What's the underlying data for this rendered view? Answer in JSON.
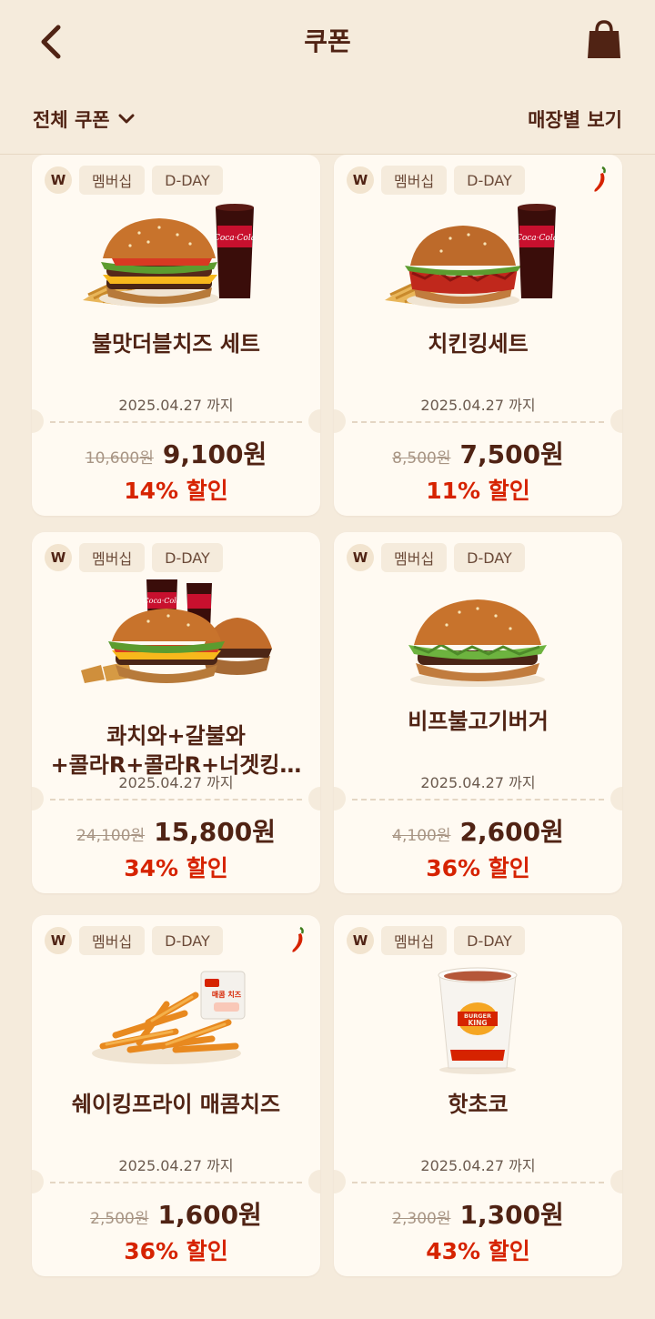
{
  "header": {
    "title": "쿠폰",
    "filter_label": "전체 쿠폰",
    "store_view_label": "매장별 보기"
  },
  "icons": {
    "back": "chevron-left-icon",
    "bag": "shopping-bag-icon",
    "filter_dropdown": "chevron-down-icon",
    "spicy": "chili-pepper-icon"
  },
  "colors": {
    "background": "#f5ebdc",
    "brand_brown": "#502314",
    "discount_red": "#d62300",
    "card": "#fffaf2"
  },
  "coupons": [
    {
      "badge": "W",
      "tag1": "멤버십",
      "tag2": "D-DAY",
      "spicy": false,
      "name_line1": "불맛더블치즈 세트",
      "name_line2": "",
      "expiry": "2025.04.27 까지",
      "original_price": "10,600원",
      "price": "9,100원",
      "discount": "14% 할인"
    },
    {
      "badge": "W",
      "tag1": "멤버십",
      "tag2": "D-DAY",
      "spicy": true,
      "name_line1": "치킨킹세트",
      "name_line2": "",
      "expiry": "2025.04.27 까지",
      "original_price": "8,500원",
      "price": "7,500원",
      "discount": "11% 할인"
    },
    {
      "badge": "W",
      "tag1": "멤버십",
      "tag2": "D-DAY",
      "spicy": false,
      "name_line1": "콰치와+갈불와",
      "name_line2": "+콜라R+콜라R+너겟킹…",
      "expiry": "2025.04.27 까지",
      "original_price": "24,100원",
      "price": "15,800원",
      "discount": "34% 할인"
    },
    {
      "badge": "W",
      "tag1": "멤버십",
      "tag2": "D-DAY",
      "spicy": false,
      "name_line1": "비프불고기버거",
      "name_line2": "",
      "expiry": "2025.04.27 까지",
      "original_price": "4,100원",
      "price": "2,600원",
      "discount": "36% 할인"
    },
    {
      "badge": "W",
      "tag1": "멤버십",
      "tag2": "D-DAY",
      "spicy": true,
      "name_line1": "쉐이킹프라이 매콤치즈",
      "name_line2": "",
      "expiry": "2025.04.27 까지",
      "original_price": "2,500원",
      "price": "1,600원",
      "discount": "36% 할인",
      "packet_label": "매콤 치즈"
    },
    {
      "badge": "W",
      "tag1": "멤버십",
      "tag2": "D-DAY",
      "spicy": false,
      "name_line1": "핫초코",
      "name_line2": "",
      "expiry": "2025.04.27 까지",
      "original_price": "2,300원",
      "price": "1,300원",
      "discount": "43% 할인",
      "cup_logo_line1": "BURGER",
      "cup_logo_line2": "KING"
    }
  ]
}
